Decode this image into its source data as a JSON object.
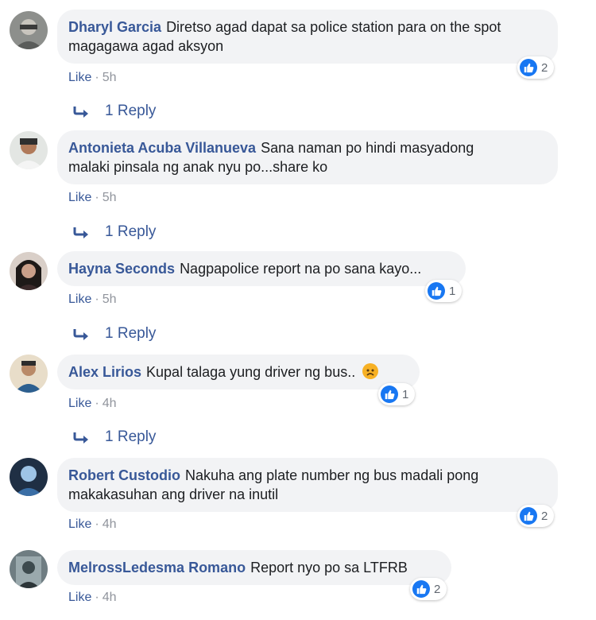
{
  "comments": [
    {
      "author": "Dharyl Garcia",
      "text_line1": "Diretso agad dapat sa police station para on the spot",
      "text_line2": "magagawa agad aksyon",
      "like_label": "Like",
      "dot": "·",
      "time": "5h",
      "reaction_count": "2",
      "reply_label": "1 Reply"
    },
    {
      "author": "Antonieta Acuba Villanueva",
      "text_line1": "Sana naman po hindi masyadong",
      "text_line2": "malaki pinsala ng anak nyu po...share ko",
      "like_label": "Like",
      "dot": "·",
      "time": "5h",
      "reply_label": "1 Reply"
    },
    {
      "author": "Hayna Seconds",
      "text_line1": "Nagpapolice report na po sana kayo...",
      "like_label": "Like",
      "dot": "·",
      "time": "5h",
      "reaction_count": "1",
      "reply_label": "1 Reply"
    },
    {
      "author": "Alex Lirios",
      "text_line1": "Kupal talaga yung driver ng bus..",
      "like_label": "Like",
      "dot": "·",
      "time": "4h",
      "reaction_count": "1",
      "reply_label": "1 Reply"
    },
    {
      "author": "Robert Custodio",
      "text_line1": "Nakuha ang plate number ng bus madali pong",
      "text_line2": "makakasuhan ang driver na inutil",
      "like_label": "Like",
      "dot": "·",
      "time": "4h",
      "reaction_count": "2"
    },
    {
      "author": "MelrossLedesma Romano",
      "text_line1": "Report nyo po sa LTFRB",
      "like_label": "Like",
      "dot": "·",
      "time": "4h",
      "reaction_count": "2"
    }
  ],
  "colors": {
    "author": "#385898",
    "bubble_bg": "#f2f3f5",
    "like_blue": "#1877f2",
    "meta_gray": "#90949c"
  },
  "icons": {
    "reaction": "like-thumb-icon",
    "reply": "reply-arrow-icon",
    "emoji": "sad-face-emoji"
  }
}
